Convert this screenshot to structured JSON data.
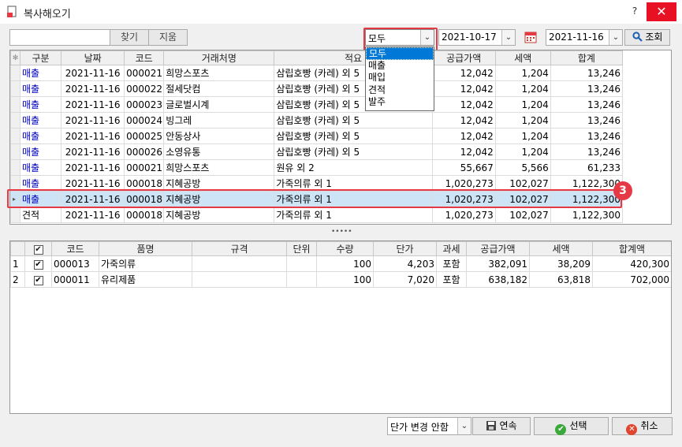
{
  "window": {
    "title": "복사해오기",
    "help": "?",
    "close": "✕"
  },
  "toolbar": {
    "search_value": "",
    "find_label": "찾기",
    "erase_label": "지움",
    "type_value": "모두",
    "type_options": [
      "모두",
      "매출",
      "매입",
      "견적",
      "발주"
    ],
    "date_from": "2021-10-17",
    "date_to": "2021-11-16",
    "query_label": "조회"
  },
  "top_grid": {
    "corner": "✻",
    "headers": [
      "구분",
      "날짜",
      "코드",
      "거래처명",
      "적요",
      "공급가액",
      "세액",
      "합계"
    ],
    "rows": [
      [
        "매출",
        "2021-11-16",
        "000021",
        "희망스포츠",
        "삼립호빵 (카레) 외 5",
        "12,042",
        "1,204",
        "13,246"
      ],
      [
        "매출",
        "2021-11-16",
        "000022",
        "절세닷컴",
        "삼립호빵 (카레) 외 5",
        "12,042",
        "1,204",
        "13,246"
      ],
      [
        "매출",
        "2021-11-16",
        "000023",
        "글로벌시계",
        "삼립호빵 (카레) 외 5",
        "12,042",
        "1,204",
        "13,246"
      ],
      [
        "매출",
        "2021-11-16",
        "000024",
        "빙그레",
        "삼립호빵 (카레) 외 5",
        "12,042",
        "1,204",
        "13,246"
      ],
      [
        "매출",
        "2021-11-16",
        "000025",
        "안동상사",
        "삼립호빵 (카레) 외 5",
        "12,042",
        "1,204",
        "13,246"
      ],
      [
        "매출",
        "2021-11-16",
        "000026",
        "소영유통",
        "삼립호빵 (카레) 외 5",
        "12,042",
        "1,204",
        "13,246"
      ],
      [
        "매출",
        "2021-11-16",
        "000021",
        "희망스포츠",
        "원유 외 2",
        "55,667",
        "5,566",
        "61,233"
      ],
      [
        "매출",
        "2021-11-16",
        "000018",
        "지혜공방",
        "가죽의류 외 1",
        "1,020,273",
        "102,027",
        "1,122,300"
      ],
      [
        "매출",
        "2021-11-16",
        "000018",
        "지혜공방",
        "가죽의류 외 1",
        "1,020,273",
        "102,027",
        "1,122,300"
      ],
      [
        "견적",
        "2021-11-16",
        "000018",
        "지혜공방",
        "가죽의류 외 1",
        "1,020,273",
        "102,027",
        "1,122,300"
      ]
    ],
    "selected_row": 8,
    "row_marker": "▸",
    "annotation_badge": "3"
  },
  "splitter": "•••••",
  "bottom_grid": {
    "headers": [
      "코드",
      "품명",
      "규격",
      "단위",
      "수량",
      "단가",
      "과세",
      "공급가액",
      "세액",
      "합계액"
    ],
    "rows": [
      {
        "num": "1",
        "checked": true,
        "cells": [
          "000013",
          "가죽의류",
          "",
          "",
          "100",
          "4,203",
          "포함",
          "382,091",
          "38,209",
          "420,300"
        ]
      },
      {
        "num": "2",
        "checked": true,
        "cells": [
          "000011",
          "유리제품",
          "",
          "",
          "100",
          "7,020",
          "포함",
          "638,182",
          "63,818",
          "702,000"
        ]
      }
    ]
  },
  "bottom_bar": {
    "price_mode": "단가 변경 안함",
    "continuous_label": "연속",
    "select_label": "선택",
    "cancel_label": "취소"
  },
  "colors": {
    "accent_red": "#e53945",
    "selection_blue": "#0078d7",
    "sales_text": "#0000c0"
  }
}
